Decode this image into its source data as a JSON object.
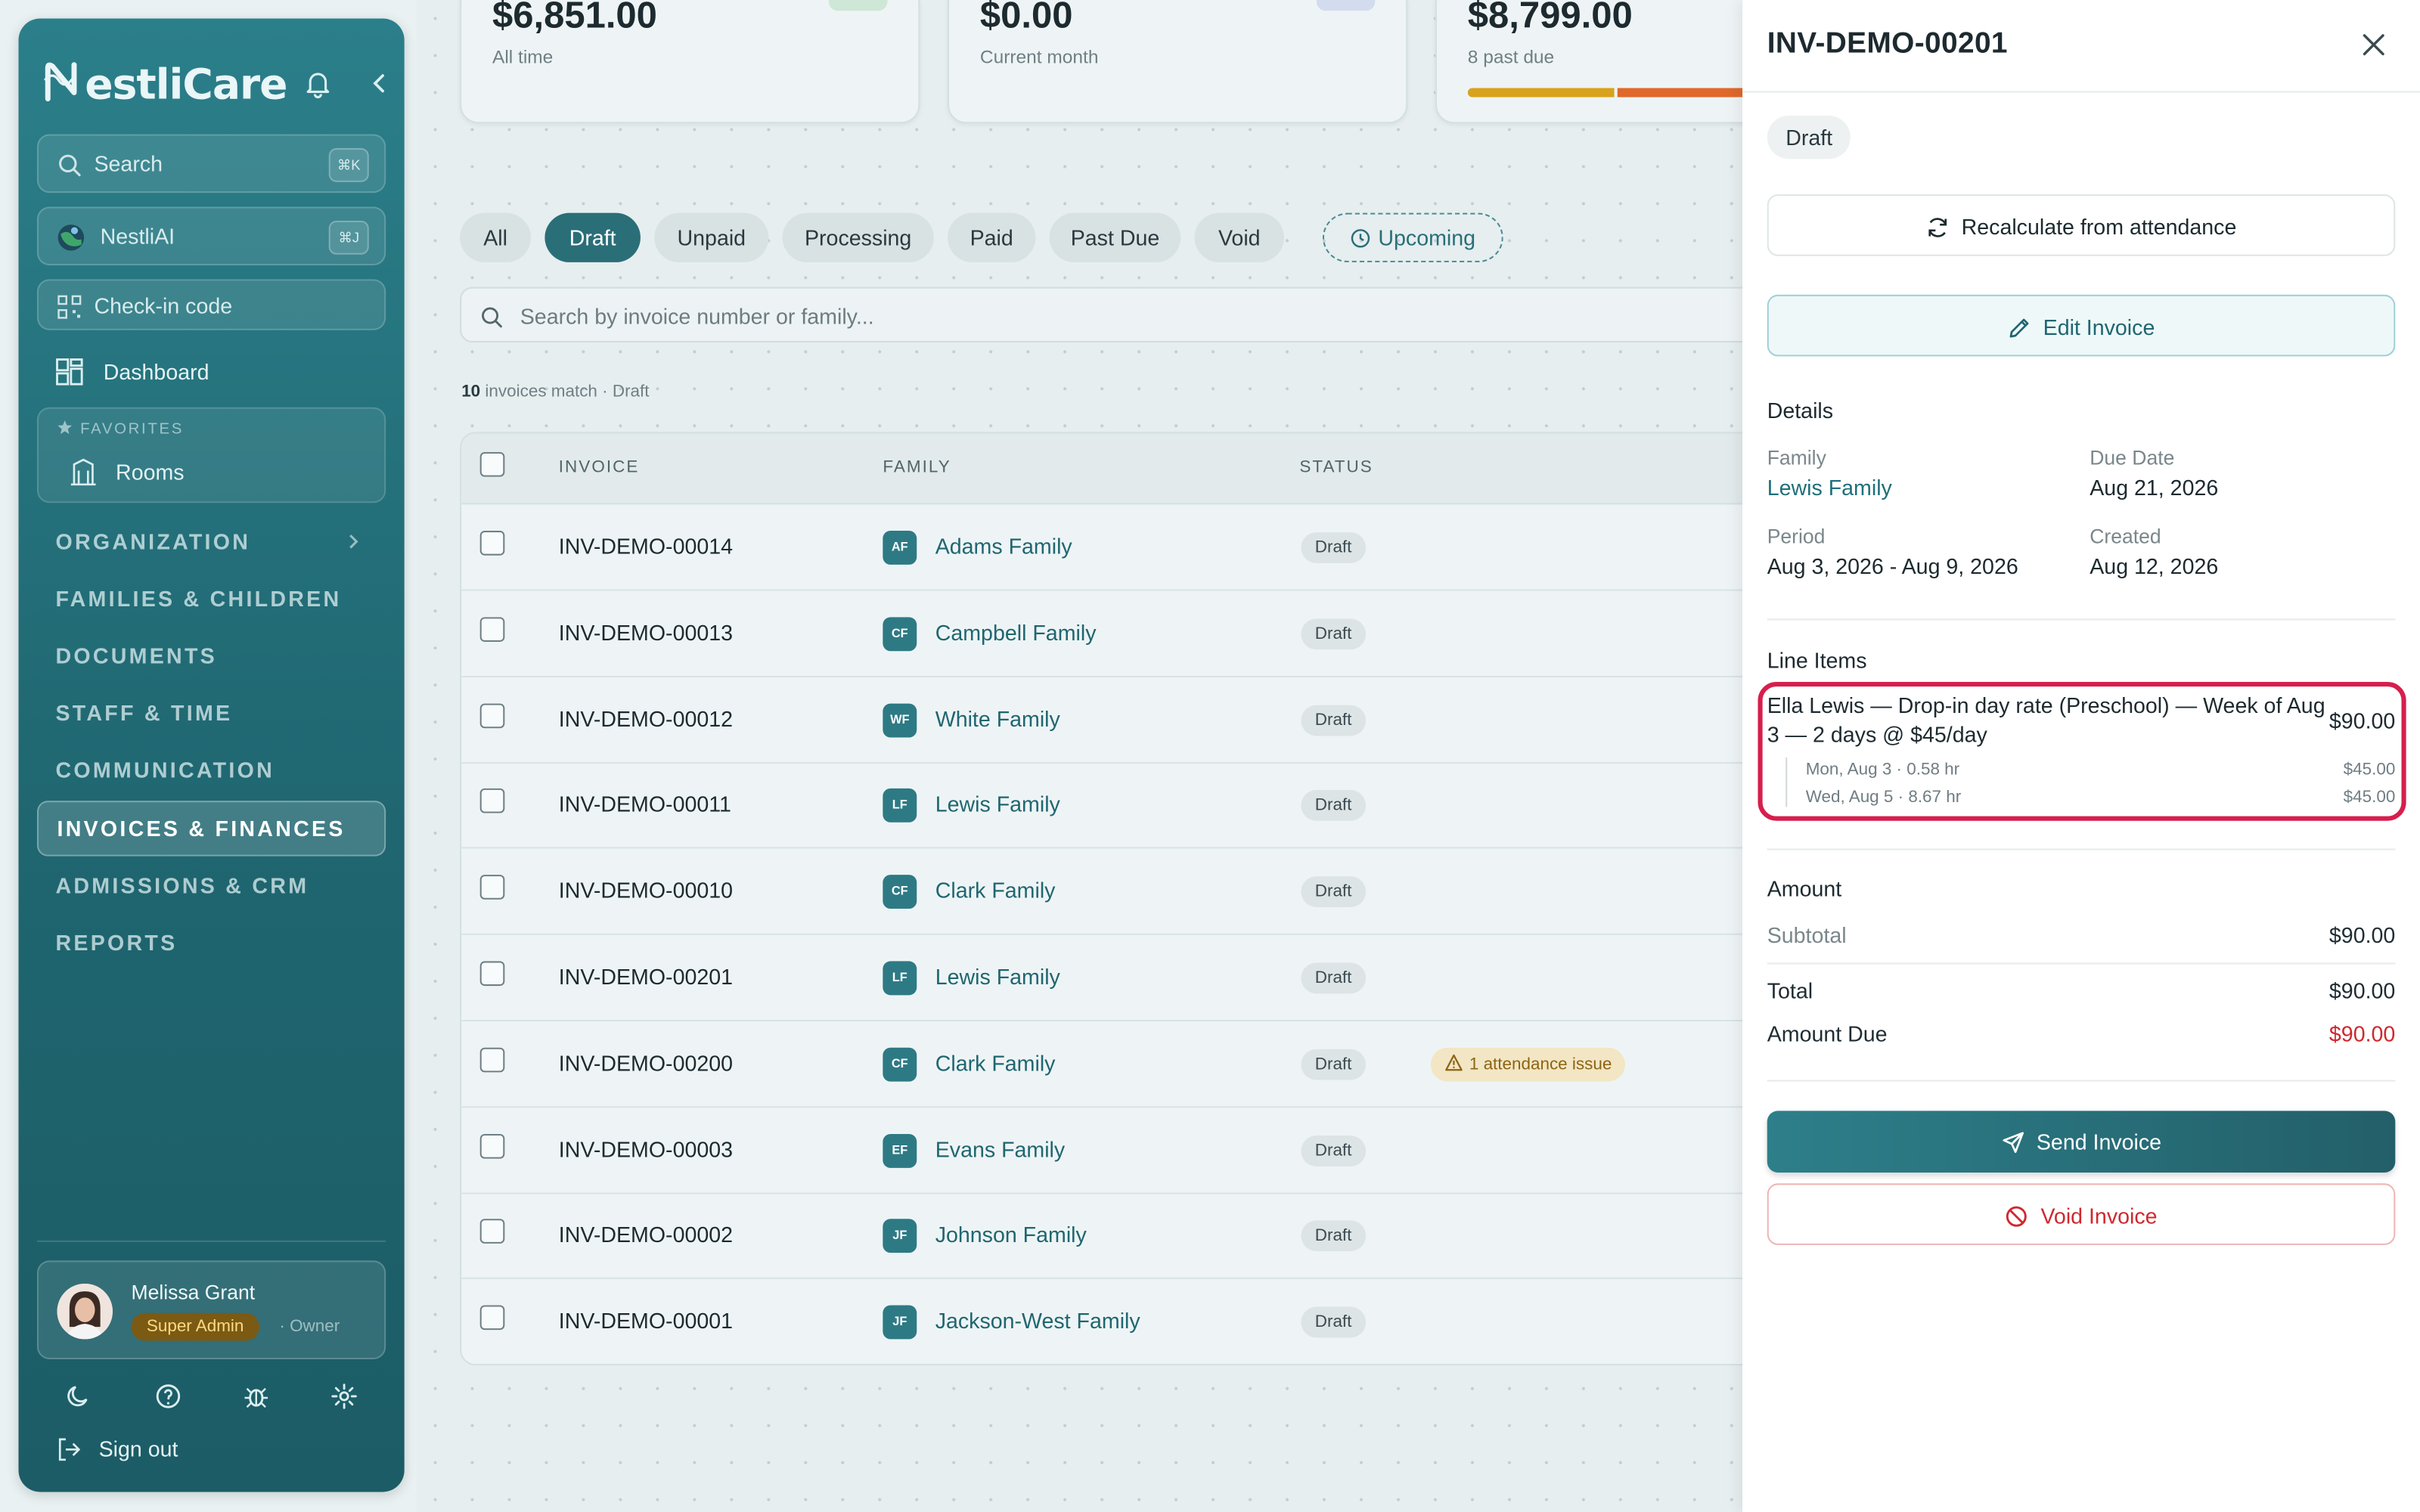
{
  "sidebar": {
    "brand": "estliCare",
    "search_label": "Search",
    "search_kbd": "⌘K",
    "ai_label": "NestliAI",
    "ai_kbd": "⌘J",
    "checkin_label": "Check-in code",
    "dashboard_label": "Dashboard",
    "favorites_title": "FAVORITES",
    "favorite_item": "Rooms",
    "sections": [
      "ORGANIZATION",
      "FAMILIES & CHILDREN",
      "DOCUMENTS",
      "STAFF & TIME",
      "COMMUNICATION",
      "INVOICES & FINANCES",
      "ADMISSIONS & CRM",
      "REPORTS"
    ],
    "active_section": "INVOICES & FINANCES",
    "user": {
      "name": "Melissa Grant",
      "role": "Super Admin",
      "title": "· Owner"
    },
    "signout_label": "Sign out"
  },
  "cards": [
    {
      "value": "$6,851.00",
      "sub": "All time"
    },
    {
      "value": "$0.00",
      "sub": "Current month"
    },
    {
      "value": "$8,799.00",
      "sub": "8 past due"
    }
  ],
  "tabs": [
    "All",
    "Draft",
    "Unpaid",
    "Processing",
    "Paid",
    "Past Due",
    "Void",
    "Upcoming"
  ],
  "active_tab": "Draft",
  "search": {
    "placeholder": "Search by invoice number or family..."
  },
  "match": {
    "count": "10",
    "text": " invoices match · Draft"
  },
  "table": {
    "headers": [
      "INVOICE",
      "FAMILY",
      "STATUS"
    ],
    "rows": [
      {
        "invoice": "INV-DEMO-00014",
        "initials": "AF",
        "family": "Adams Family",
        "status": "Draft"
      },
      {
        "invoice": "INV-DEMO-00013",
        "initials": "CF",
        "family": "Campbell Family",
        "status": "Draft"
      },
      {
        "invoice": "INV-DEMO-00012",
        "initials": "WF",
        "family": "White Family",
        "status": "Draft"
      },
      {
        "invoice": "INV-DEMO-00011",
        "initials": "LF",
        "family": "Lewis Family",
        "status": "Draft"
      },
      {
        "invoice": "INV-DEMO-00010",
        "initials": "CF",
        "family": "Clark Family",
        "status": "Draft"
      },
      {
        "invoice": "INV-DEMO-00201",
        "initials": "LF",
        "family": "Lewis Family",
        "status": "Draft"
      },
      {
        "invoice": "INV-DEMO-00200",
        "initials": "CF",
        "family": "Clark Family",
        "status": "Draft",
        "warning": "1 attendance issue"
      },
      {
        "invoice": "INV-DEMO-00003",
        "initials": "EF",
        "family": "Evans Family",
        "status": "Draft"
      },
      {
        "invoice": "INV-DEMO-00002",
        "initials": "JF",
        "family": "Johnson Family",
        "status": "Draft"
      },
      {
        "invoice": "INV-DEMO-00001",
        "initials": "JF",
        "family": "Jackson-West Family",
        "status": "Draft"
      }
    ]
  },
  "drawer": {
    "title": "INV-DEMO-00201",
    "status": "Draft",
    "recalc_label": "Recalculate from attendance",
    "edit_label": "Edit Invoice",
    "details_title": "Details",
    "family_label": "Family",
    "family_value": "Lewis Family",
    "due_label": "Due Date",
    "due_value": "Aug 21, 2026",
    "period_label": "Period",
    "period_value": "Aug 3, 2026 - Aug 9, 2026",
    "created_label": "Created",
    "created_value": "Aug 12, 2026",
    "line_items_title": "Line Items",
    "line_item": {
      "description": "Ella Lewis — Drop-in day rate (Preschool) — Week of Aug 3 — 2 days @ $45/day",
      "amount": "$90.00",
      "sub": [
        {
          "label": "Mon, Aug 3 · 0.58 hr",
          "amount": "$45.00"
        },
        {
          "label": "Wed, Aug 5 · 8.67 hr",
          "amount": "$45.00"
        }
      ]
    },
    "amount_title": "Amount",
    "subtotal_label": "Subtotal",
    "subtotal_value": "$90.00",
    "total_label": "Total",
    "total_value": "$90.00",
    "due_amount_label": "Amount Due",
    "due_amount_value": "$90.00",
    "send_label": "Send Invoice",
    "void_label": "Void Invoice"
  },
  "colors": {
    "brand": "#2b7f8a",
    "accent": "#1f6670",
    "danger": "#d0282e",
    "highlight": "#d61f4d",
    "warning": "#8c6414"
  }
}
